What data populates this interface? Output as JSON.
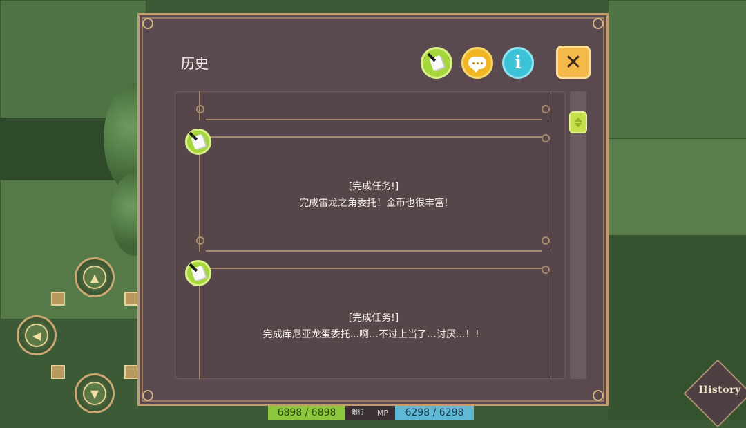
{
  "window": {
    "title": "历史"
  },
  "toolbar": {
    "quest_icon": "quest-paper-icon",
    "chat_icon": "chat-bubble-icon",
    "info_label": "i",
    "close_label": "✕",
    "colors": {
      "quest": "#a5d63a",
      "chat": "#f0b624",
      "info": "#3cc3d8",
      "close": "#f5b94a"
    }
  },
  "history": {
    "entries": [
      {
        "type": "quest",
        "heading": "",
        "text": ""
      },
      {
        "type": "quest",
        "heading": "[完成任务!]",
        "text": "完成雷龙之角委托！金币也很丰富!"
      },
      {
        "type": "quest",
        "heading": "[完成任务!]",
        "text": "完成库尼亚龙蛋委托...啊…不过上当了…讨厌...！！"
      }
    ]
  },
  "status_bar": {
    "hp": "6898 / 6898",
    "mid_label": "銀行",
    "mp_label": "MP",
    "mp": "6298 / 6298"
  },
  "corner_button": {
    "label": "History"
  }
}
